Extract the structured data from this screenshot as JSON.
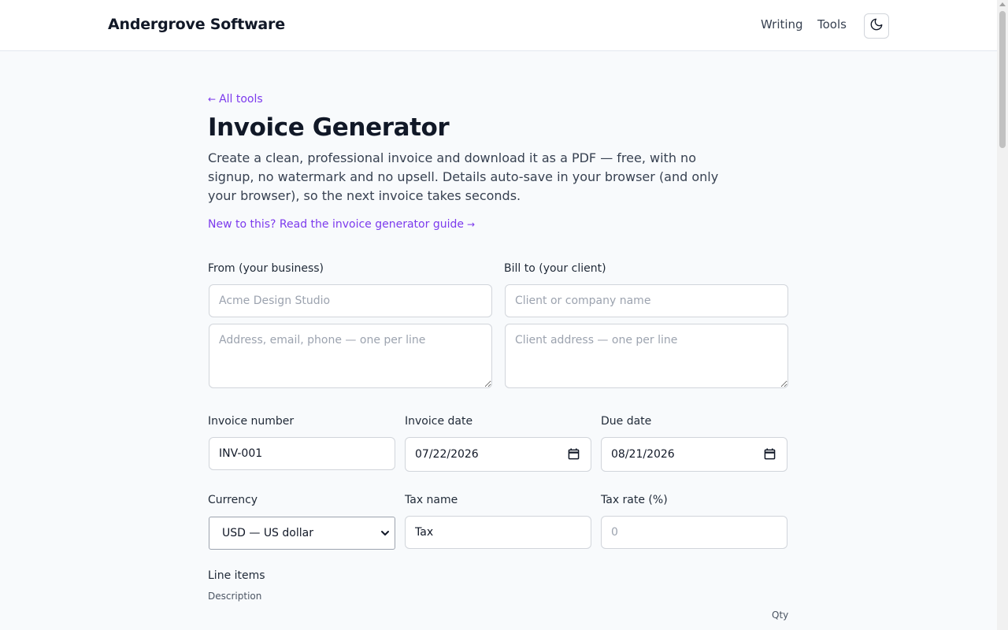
{
  "header": {
    "brand": "Andergrove Software",
    "nav": [
      "Writing",
      "Tools"
    ],
    "theme_icon": "moon-icon"
  },
  "main": {
    "back_arrow": "←",
    "back_link": "All tools",
    "title": "Invoice Generator",
    "intro": "Create a clean, professional invoice and download it as a PDF — free, with no signup, no watermark and no upsell. Details auto-save in your browser (and only your browser), so the next invoice takes seconds.",
    "guide_link": "New to this? Read the invoice generator guide",
    "guide_arrow": "→"
  },
  "form": {
    "from_label": "From (your business)",
    "from_name_placeholder": "Acme Design Studio",
    "from_address_placeholder": "Address, email, phone — one per line",
    "bill_label": "Bill to (your client)",
    "client_name_placeholder": "Client or company name",
    "client_address_placeholder": "Client address — one per line",
    "invoice_number_label": "Invoice number",
    "invoice_number_value": "INV-001",
    "invoice_date_label": "Invoice date",
    "invoice_date_value": "07/22/2026",
    "due_date_label": "Due date",
    "due_date_value": "08/21/2026",
    "currency_label": "Currency",
    "currency_value": "USD — US dollar",
    "tax_name_label": "Tax name",
    "tax_name_value": "Tax",
    "tax_rate_label": "Tax rate (%)",
    "tax_rate_placeholder": "0",
    "line_items_label": "Line items",
    "col_description": "Description",
    "col_qty": "Qty"
  },
  "colors": {
    "accent": "#7c3aed",
    "background": "#f8fafc",
    "header_bg": "#ffffff",
    "border": "#d1d5db"
  }
}
